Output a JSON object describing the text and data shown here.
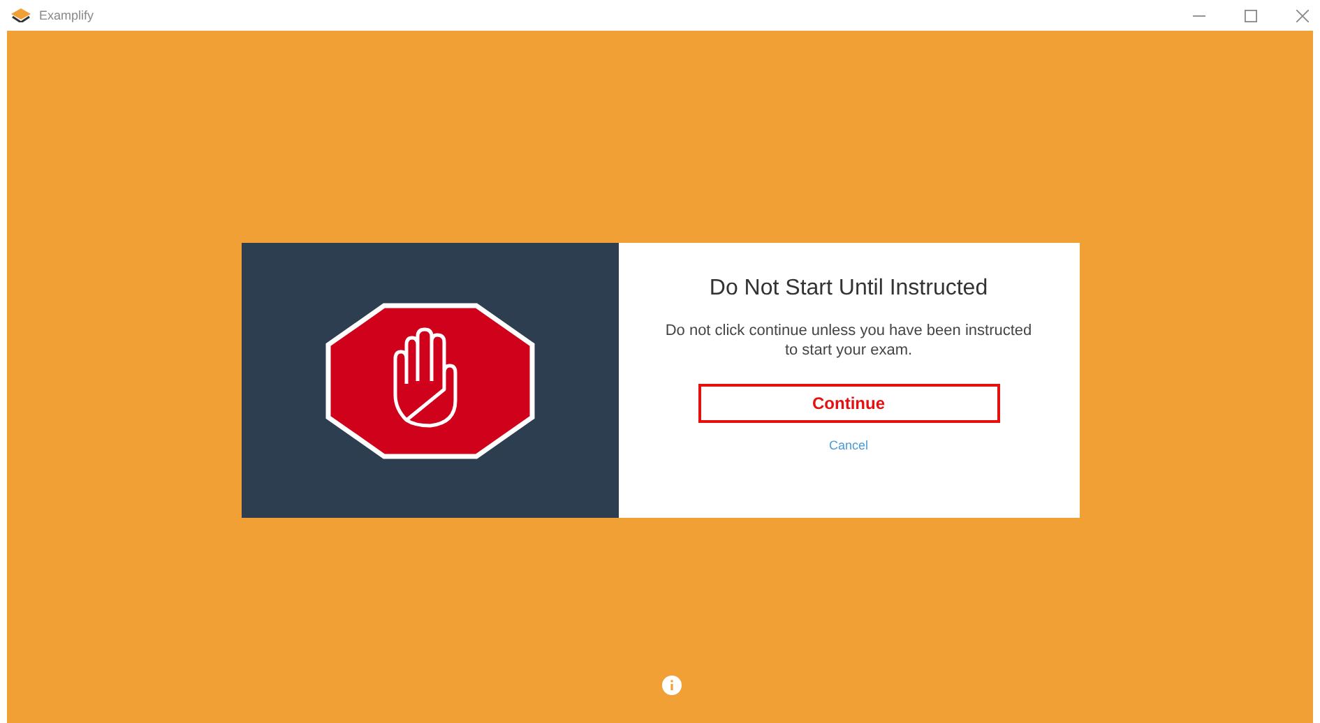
{
  "window": {
    "title": "Examplify"
  },
  "dialog": {
    "title": "Do Not Start Until Instructed",
    "message": "Do not click continue unless you have been instructed to start your exam.",
    "continue_button": "Continue",
    "cancel_link": "Cancel"
  }
}
